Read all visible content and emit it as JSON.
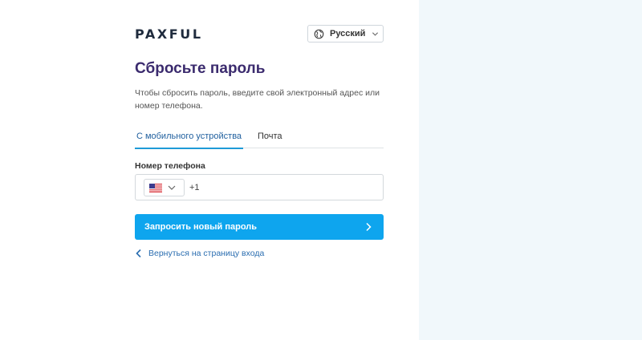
{
  "logo": {
    "text": "PAXFUL"
  },
  "language": {
    "label": "Русский",
    "icon": "globe-icon"
  },
  "title": "Сбросьте пароль",
  "description": "Чтобы сбросить пароль, введите свой электронный адрес или номер телефона.",
  "tabs": [
    {
      "label": "С мобильного устройства",
      "active": true
    },
    {
      "label": "Почта",
      "active": false
    }
  ],
  "phone": {
    "label": "Номер телефона",
    "country_flag": "us-flag-icon",
    "prefix": "+1",
    "value": ""
  },
  "submit": {
    "label": "Запросить новый пароль",
    "icon": "chevron-right-icon"
  },
  "back_link": {
    "label": "Вернуться на страницу входа",
    "icon": "chevron-left-icon"
  },
  "colors": {
    "brand_dark": "#1f2b3d",
    "title": "#3b2b6e",
    "accent": "#0ea5ee",
    "tab_active": "#1e9bd7",
    "link": "#2a6db0",
    "side_panel": "#f1f8fb"
  }
}
